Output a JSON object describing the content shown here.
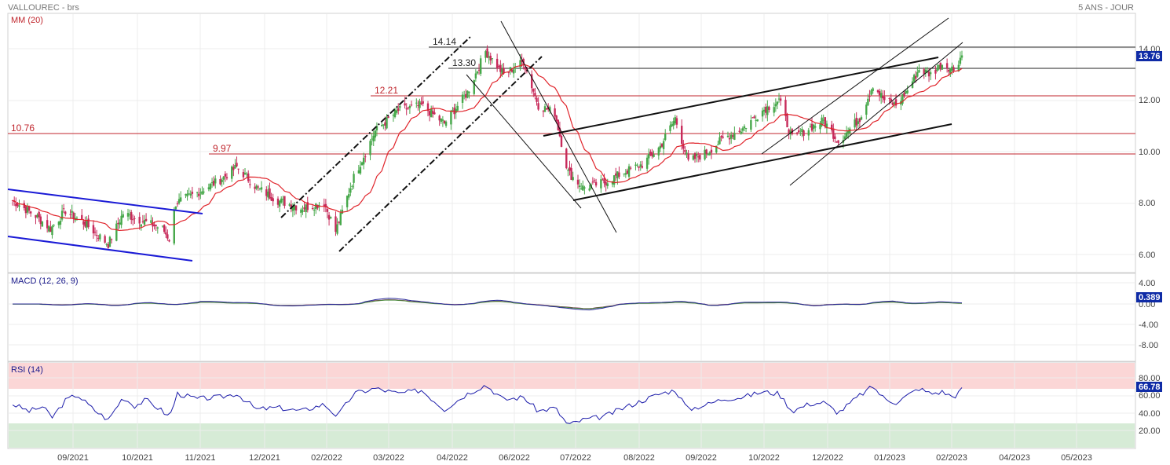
{
  "header": {
    "title": "VALLOUREC - brs",
    "period": "5 ANS - JOUR"
  },
  "chart_data": [
    {
      "type": "candlestick",
      "panel": "price",
      "indicator_label": "MM (20)",
      "y_ticks": [
        "6.00",
        "8.00",
        "10.00",
        "12.00",
        "14.00"
      ],
      "ylim": [
        5.4,
        15.0
      ],
      "last_value": "13.76",
      "last_value_num": 13.76,
      "x_ticks": [
        "09/2021",
        "10/2021",
        "11/2021",
        "12/2021",
        "02/2022",
        "03/2022",
        "04/2022",
        "06/2022",
        "07/2022",
        "08/2022",
        "09/2022",
        "10/2022",
        "12/2022",
        "01/2023",
        "02/2023",
        "04/2023",
        "05/2023"
      ],
      "closes": [
        {
          "d": "2021-08-02",
          "v": 8.1
        },
        {
          "d": "2021-08-16",
          "v": 7.5
        },
        {
          "d": "2021-08-25",
          "v": 7.0
        },
        {
          "d": "2021-09-03",
          "v": 7.7
        },
        {
          "d": "2021-09-15",
          "v": 7.2
        },
        {
          "d": "2021-09-29",
          "v": 6.4
        },
        {
          "d": "2021-10-08",
          "v": 7.6
        },
        {
          "d": "2021-10-20",
          "v": 7.3
        },
        {
          "d": "2021-11-01",
          "v": 7.0
        },
        {
          "d": "2021-11-05",
          "v": 6.6
        },
        {
          "d": "2021-11-09",
          "v": 8.0
        },
        {
          "d": "2021-11-22",
          "v": 8.4
        },
        {
          "d": "2021-12-06",
          "v": 8.9
        },
        {
          "d": "2021-12-16",
          "v": 9.4
        },
        {
          "d": "2021-12-28",
          "v": 8.6
        },
        {
          "d": "2022-01-10",
          "v": 8.1
        },
        {
          "d": "2022-01-24",
          "v": 7.8
        },
        {
          "d": "2022-02-07",
          "v": 8.0
        },
        {
          "d": "2022-02-14",
          "v": 6.9
        },
        {
          "d": "2022-02-25",
          "v": 9.0
        },
        {
          "d": "2022-03-10",
          "v": 10.8
        },
        {
          "d": "2022-03-24",
          "v": 11.6
        },
        {
          "d": "2022-04-07",
          "v": 11.8
        },
        {
          "d": "2022-04-21",
          "v": 11.1
        },
        {
          "d": "2022-05-05",
          "v": 12.3
        },
        {
          "d": "2022-05-16",
          "v": 13.9
        },
        {
          "d": "2022-05-27",
          "v": 13.0
        },
        {
          "d": "2022-06-08",
          "v": 13.5
        },
        {
          "d": "2022-06-17",
          "v": 11.8
        },
        {
          "d": "2022-06-27",
          "v": 11.5
        },
        {
          "d": "2022-07-05",
          "v": 9.2
        },
        {
          "d": "2022-07-14",
          "v": 8.6
        },
        {
          "d": "2022-07-27",
          "v": 8.8
        },
        {
          "d": "2022-08-08",
          "v": 9.2
        },
        {
          "d": "2022-08-19",
          "v": 9.5
        },
        {
          "d": "2022-08-30",
          "v": 10.2
        },
        {
          "d": "2022-09-08",
          "v": 11.3
        },
        {
          "d": "2022-09-16",
          "v": 9.6
        },
        {
          "d": "2022-09-28",
          "v": 10.0
        },
        {
          "d": "2022-10-07",
          "v": 10.5
        },
        {
          "d": "2022-10-19",
          "v": 10.9
        },
        {
          "d": "2022-10-31",
          "v": 11.6
        },
        {
          "d": "2022-11-10",
          "v": 12.0
        },
        {
          "d": "2022-11-18",
          "v": 10.5
        },
        {
          "d": "2022-11-28",
          "v": 10.9
        },
        {
          "d": "2022-12-07",
          "v": 11.2
        },
        {
          "d": "2022-12-16",
          "v": 10.4
        },
        {
          "d": "2022-12-29",
          "v": 11.3
        },
        {
          "d": "2023-01-06",
          "v": 12.6
        },
        {
          "d": "2023-01-13",
          "v": 12.0
        },
        {
          "d": "2023-01-20",
          "v": 11.8
        },
        {
          "d": "2023-01-27",
          "v": 12.4
        },
        {
          "d": "2023-02-03",
          "v": 13.2
        },
        {
          "d": "2023-02-10",
          "v": 13.0
        },
        {
          "d": "2023-02-17",
          "v": 13.4
        },
        {
          "d": "2023-02-24",
          "v": 13.2
        },
        {
          "d": "2023-03-01",
          "v": 13.76
        }
      ],
      "levels": [
        {
          "label": "14.14",
          "value": 14.14,
          "color": "#222222"
        },
        {
          "label": "13.30",
          "value": 13.3,
          "color": "#222222"
        },
        {
          "label": "12.21",
          "value": 12.21,
          "color": "#c0262d"
        },
        {
          "label": "10.76",
          "value": 10.76,
          "color": "#c0262d"
        },
        {
          "label": "9.97",
          "value": 9.97,
          "color": "#c0262d"
        }
      ],
      "colors": {
        "up": "#46a84a",
        "down": "#c72a5a",
        "ma": "#e0242b",
        "trend_blue": "#1a1ad6",
        "trend_black": "#111111",
        "level_red": "#c0262d"
      }
    },
    {
      "type": "line",
      "panel": "macd",
      "indicator_label": "MACD (12, 26, 9)",
      "y_ticks": [
        "4.00",
        "0.00",
        "-4.00",
        "-8.00"
      ],
      "ylim": [
        -10,
        6
      ],
      "last_value": "0.389",
      "series_colors": [
        "#7a1c4a",
        "#4a8a3a",
        "#2a2a9a"
      ]
    },
    {
      "type": "line",
      "panel": "rsi",
      "indicator_label": "RSI (14)",
      "y_ticks": [
        "80.00",
        "60.00",
        "40.00",
        "20.00"
      ],
      "ylim": [
        0,
        100
      ],
      "overbought": 70,
      "oversold": 30,
      "last_value": "66.78",
      "rsi_points": [
        {
          "d": "2021-08-02",
          "v": 50
        },
        {
          "d": "2021-08-12",
          "v": 42
        },
        {
          "d": "2021-08-20",
          "v": 47
        },
        {
          "d": "2021-08-26",
          "v": 35
        },
        {
          "d": "2021-09-03",
          "v": 54
        },
        {
          "d": "2021-09-10",
          "v": 61
        },
        {
          "d": "2021-09-20",
          "v": 44
        },
        {
          "d": "2021-09-29",
          "v": 32
        },
        {
          "d": "2021-10-08",
          "v": 58
        },
        {
          "d": "2021-10-15",
          "v": 48
        },
        {
          "d": "2021-10-22",
          "v": 55
        },
        {
          "d": "2021-11-01",
          "v": 42
        },
        {
          "d": "2021-11-05",
          "v": 35
        },
        {
          "d": "2021-11-10",
          "v": 62
        },
        {
          "d": "2021-11-22",
          "v": 56
        },
        {
          "d": "2021-12-06",
          "v": 58
        },
        {
          "d": "2021-12-16",
          "v": 62
        },
        {
          "d": "2021-12-28",
          "v": 44
        },
        {
          "d": "2022-01-10",
          "v": 46
        },
        {
          "d": "2022-01-24",
          "v": 42
        },
        {
          "d": "2022-02-07",
          "v": 50
        },
        {
          "d": "2022-02-15",
          "v": 36
        },
        {
          "d": "2022-02-25",
          "v": 62
        },
        {
          "d": "2022-03-10",
          "v": 68
        },
        {
          "d": "2022-03-24",
          "v": 62
        },
        {
          "d": "2022-04-07",
          "v": 66
        },
        {
          "d": "2022-04-21",
          "v": 44
        },
        {
          "d": "2022-05-05",
          "v": 62
        },
        {
          "d": "2022-05-16",
          "v": 72
        },
        {
          "d": "2022-05-27",
          "v": 55
        },
        {
          "d": "2022-06-08",
          "v": 58
        },
        {
          "d": "2022-06-17",
          "v": 42
        },
        {
          "d": "2022-06-27",
          "v": 46
        },
        {
          "d": "2022-07-05",
          "v": 26
        },
        {
          "d": "2022-07-14",
          "v": 32
        },
        {
          "d": "2022-07-27",
          "v": 36
        },
        {
          "d": "2022-08-08",
          "v": 46
        },
        {
          "d": "2022-08-19",
          "v": 54
        },
        {
          "d": "2022-08-30",
          "v": 62
        },
        {
          "d": "2022-09-08",
          "v": 66
        },
        {
          "d": "2022-09-16",
          "v": 44
        },
        {
          "d": "2022-09-28",
          "v": 50
        },
        {
          "d": "2022-10-07",
          "v": 56
        },
        {
          "d": "2022-10-19",
          "v": 58
        },
        {
          "d": "2022-10-31",
          "v": 64
        },
        {
          "d": "2022-11-10",
          "v": 62
        },
        {
          "d": "2022-11-18",
          "v": 42
        },
        {
          "d": "2022-11-28",
          "v": 50
        },
        {
          "d": "2022-12-07",
          "v": 52
        },
        {
          "d": "2022-12-16",
          "v": 40
        },
        {
          "d": "2022-12-29",
          "v": 60
        },
        {
          "d": "2023-01-06",
          "v": 70
        },
        {
          "d": "2023-01-13",
          "v": 56
        },
        {
          "d": "2023-01-20",
          "v": 52
        },
        {
          "d": "2023-01-27",
          "v": 60
        },
        {
          "d": "2023-02-03",
          "v": 68
        },
        {
          "d": "2023-02-10",
          "v": 62
        },
        {
          "d": "2023-02-17",
          "v": 64
        },
        {
          "d": "2023-02-24",
          "v": 58
        },
        {
          "d": "2023-03-01",
          "v": 66.78
        }
      ],
      "colors": {
        "line": "#1c1caa",
        "ob_zone": "#fbd6d6",
        "os_zone": "#d6ebd6",
        "tag": "#0f2ba6"
      }
    }
  ]
}
